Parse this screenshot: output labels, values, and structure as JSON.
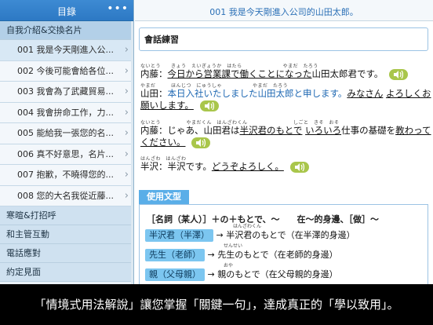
{
  "sidebar": {
    "title": "目錄",
    "more": "•••",
    "categories": [
      {
        "label": "自我介紹&交換名片"
      },
      {
        "label": "寒暄&打招呼"
      },
      {
        "label": "和主管互動"
      },
      {
        "label": "電話應對"
      },
      {
        "label": "約定見面"
      }
    ],
    "items": [
      {
        "label": "001 我是今天剛進入公..."
      },
      {
        "label": "002 今後可能會給各位..."
      },
      {
        "label": "003 我會為了武藏貿易..."
      },
      {
        "label": "004 我會拚命工作，力..."
      },
      {
        "label": "005 能給我一張您的名..."
      },
      {
        "label": "006 真不好意思，名片..."
      },
      {
        "label": "007 抱歉，不曉得您的..."
      },
      {
        "label": "008 您的大名我從近藤..."
      }
    ]
  },
  "main": {
    "title": "001 我是今天剛進入公司的山田太郎。",
    "section_label": "會話練習",
    "dialog": [
      {
        "ruby": "ないとう　　きょう　えいぎょうか　はたら　　　　　　　　やまだ　たろう",
        "speaker": "内藤：",
        "text": "今日から営業課で働くことになった",
        "tail": "山田太郎君です。"
      },
      {
        "ruby": "やまだ　　　ほんじつ　にゅうしゃ　　　　　　やまだ　たろう",
        "speaker": "山田：",
        "text": "本日入社いたしました山田太郎と申します。",
        "tail_ul": "みなさん",
        "tail2": "よろしくお",
        "line2": "願いします。"
      },
      {
        "ruby": "ないとう　　　　　やまだくん　はんざわくん　　　　　　　　　しごと　きそ　おそ",
        "speaker": "内藤：",
        "text": "じゃあ、山田君は",
        "ul1": "半沢君のもとで",
        "ul2": "いろいろ",
        "mid": "仕事の基礎を",
        "ul3": "教わって",
        "line2": "ください。"
      },
      {
        "ruby": "はんざわ　はんざわ",
        "speaker": "半沢：",
        "text": "半沢です。",
        "ul1": "どうぞよろしく。"
      }
    ],
    "usage_label": "使用文型",
    "pattern": "［名詞（某人）］＋の＋もとで、～　　在～的身邊、［做］～",
    "examples": [
      {
        "ruby": "はんざわくん",
        "tag": "半沢君（半澤）",
        "arrow": "→",
        "text": "半沢君のもとで（在半澤的身邊）"
      },
      {
        "ruby": "せんせい",
        "tag": "先生（老師）",
        "arrow": "→",
        "text": "先生のもとで（在老師的身邊）"
      },
      {
        "ruby": "おや",
        "tag": "親（父母親）",
        "arrow": "→",
        "text": "親のもとで（在父母親的身邊）"
      }
    ]
  },
  "caption": "「情境式用法解說」讓您掌握「關鍵一句」，達成真正的「學以致用」。",
  "colors": {
    "header_blue": "#2d79c4",
    "accent_green": "#a9c64b",
    "pill_blue": "#7cc6f0"
  }
}
